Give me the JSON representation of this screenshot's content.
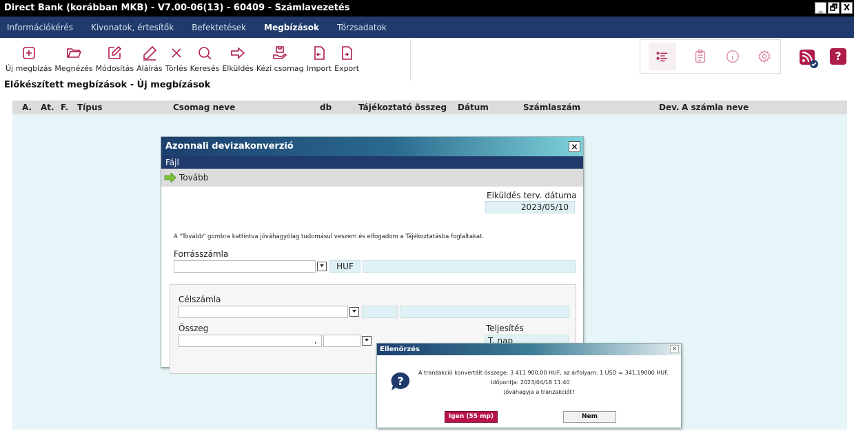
{
  "window": {
    "title": "Direct Bank (korábban MKB) - V7.00-06(13) - 60409 - Számlavezetés",
    "min_label": "_",
    "max_label": "🗗",
    "close_label": "X"
  },
  "menu": [
    "Információkérés",
    "Kivonatok, értesítők",
    "Befektetések",
    "Megbízások",
    "Törzsadatok"
  ],
  "toolbar": {
    "new": "Új megbízás",
    "view": "Megnézés",
    "edit": "Módosítás",
    "sign": "Aláírás",
    "delete": "Törlés",
    "search": "Keresés",
    "send": "Elküldés",
    "manual": "Kézi csomag",
    "import": "Import",
    "export": "Export"
  },
  "help_label": "?",
  "page_title": "Előkészített megbízások - Új megbízások",
  "grid_columns": [
    "A.",
    "At.",
    "F.",
    "Típus",
    "Csomag neve",
    "db",
    "Tájékoztató összeg",
    "Dátum",
    "Számlaszám",
    "Dev.",
    "A számla neve"
  ],
  "dialog": {
    "title": "Azonnali devizakonverzió",
    "close_label": "×",
    "menu": "Fájl",
    "next_button": "Tovább",
    "send_date_label": "Elküldés terv. dátuma",
    "send_date_value": "2023/05/10",
    "notice": "A \"Tovább\" gombra kattintva jóváhagyólag tudomásul veszem és elfogadom a Tájékoztatásba foglaltakat.",
    "source_label": "Forrásszámla",
    "source_currency": "HUF",
    "target_label": "Célszámla",
    "amount_label": "Összeg",
    "amount_decimal": ",",
    "settlement_label": "Teljesítés",
    "settlement_value": "T. nap"
  },
  "confirm": {
    "title": "Ellenőrzés",
    "close_label": "×",
    "line1": "A tranzakció konvertált összege: 3 411 900,00 HUF, az árfolyam: 1 USD = 341,19000 HUF.",
    "line2": "Időpontja: 2023/04/18 11:40",
    "line3": "Jóváhagyja a tranzakciót?",
    "yes_button": "Igen (55 mp)",
    "no_button": "Nem",
    "icon_label": "?"
  }
}
